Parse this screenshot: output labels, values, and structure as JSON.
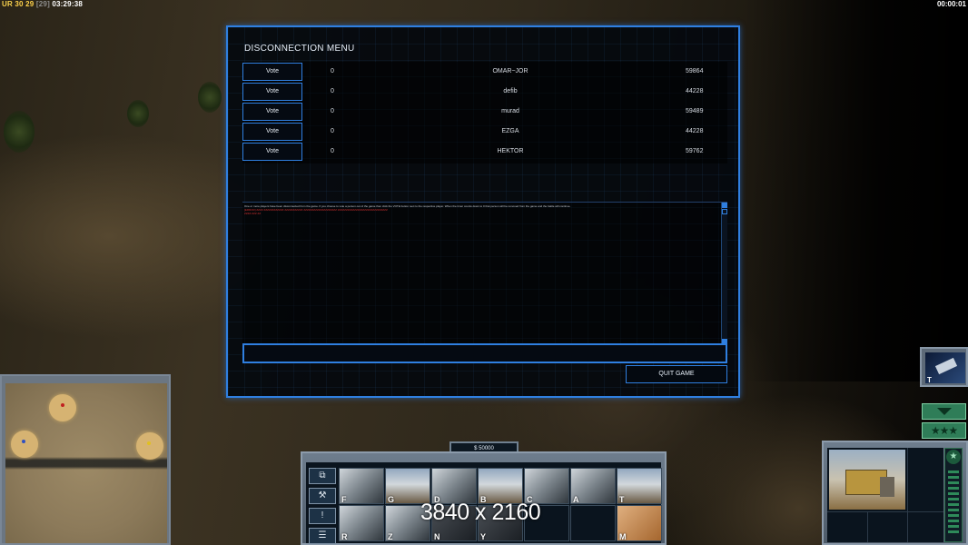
{
  "hud": {
    "faction": "UR",
    "stat1": "30",
    "stat2": "29",
    "stat3": "[29]",
    "clock": "03:29:38",
    "timer": "00:00:01"
  },
  "dialog": {
    "title": "DISCONNECTION MENU",
    "players": [
      {
        "vote_label": "Vote",
        "votes": "0",
        "name": "OMAR~JOR",
        "ping": "59864"
      },
      {
        "vote_label": "Vote",
        "votes": "0",
        "name": "defib",
        "ping": "44228"
      },
      {
        "vote_label": "Vote",
        "votes": "0",
        "name": "murad",
        "ping": "59489"
      },
      {
        "vote_label": "Vote",
        "votes": "0",
        "name": "EZGA",
        "ping": "44228"
      },
      {
        "vote_label": "Vote",
        "votes": "0",
        "name": "HEKTOR",
        "ping": "59762"
      }
    ],
    "messages": [
      "One or more players have been disconnected from the game. If you choose to vote a person out of the game then click the VOTE button next to the respective player. When the timer counts down to 0 that person will be removed from the game and the battle will continue.",
      "[ERROR] ZZZZ ZZZZZZZZZZZZ ZZZZZZZZZZZ ZZZZZZZZZZZZZZZZZZZZ ZZZZZZZZZZZZZZZZZZZZZZZZZZZZZZ",
      "ZZZZ ZZZ ZZ"
    ],
    "chat_value": "",
    "quit_label": "QUIT GAME"
  },
  "command_bar": {
    "money": "$ 50000",
    "slots_row1_hotkeys": [
      "F",
      "G",
      "D",
      "B",
      "C",
      "A",
      "T"
    ],
    "slots_row2_hotkeys": [
      "R",
      "Z",
      "N",
      "Y",
      "",
      "",
      "M"
    ],
    "resolution_overlay": "3840 x 2160"
  },
  "general_power": {
    "hotkey": "T"
  },
  "side_buttons": [
    "⧉",
    "⚒",
    "!",
    "☰"
  ],
  "rank_star": "★",
  "stars_label": "★★★",
  "colors": {
    "accent_blue": "#2f7fe0",
    "hud_yellow": "#f6d04d",
    "rank_green": "#2f7d58"
  }
}
